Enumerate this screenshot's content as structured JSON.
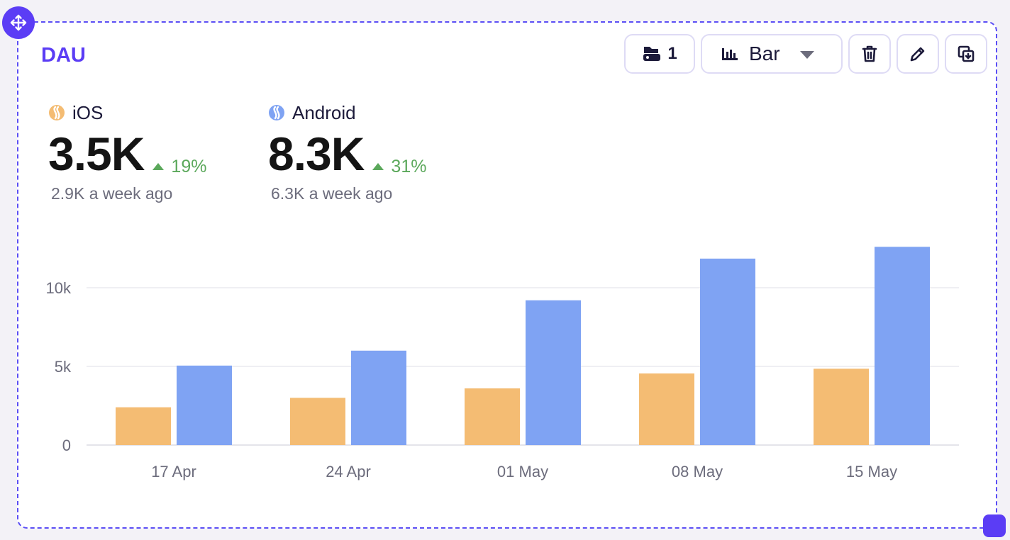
{
  "card": {
    "title": "DAU"
  },
  "toolbar": {
    "layers_count": "1",
    "chart_type_label": "Bar"
  },
  "metrics": [
    {
      "series": "iOS",
      "value": "3.5K",
      "change": "19%",
      "previous": "2.9K a week ago",
      "color": "#f4bc73"
    },
    {
      "series": "Android",
      "value": "8.3K",
      "change": "31%",
      "previous": "6.3K a week ago",
      "color": "#7fa3f3"
    }
  ],
  "colors": {
    "accent": "#5b3df5",
    "ios": "#f4bc73",
    "android": "#7fa3f3",
    "positive": "#5ba85b"
  },
  "chart_data": {
    "type": "bar",
    "categories": [
      "17 Apr",
      "24 Apr",
      "01 May",
      "08 May",
      "15 May"
    ],
    "series": [
      {
        "name": "iOS",
        "values": [
          2400,
          3000,
          3600,
          4550,
          4850
        ]
      },
      {
        "name": "Android",
        "values": [
          5050,
          6000,
          9200,
          11850,
          12600
        ]
      }
    ],
    "yticks": [
      0,
      5000,
      10000
    ],
    "ytick_labels": [
      "0",
      "5k",
      "10k"
    ],
    "ylim": [
      0,
      13000
    ],
    "grid": true,
    "legend": "none"
  }
}
